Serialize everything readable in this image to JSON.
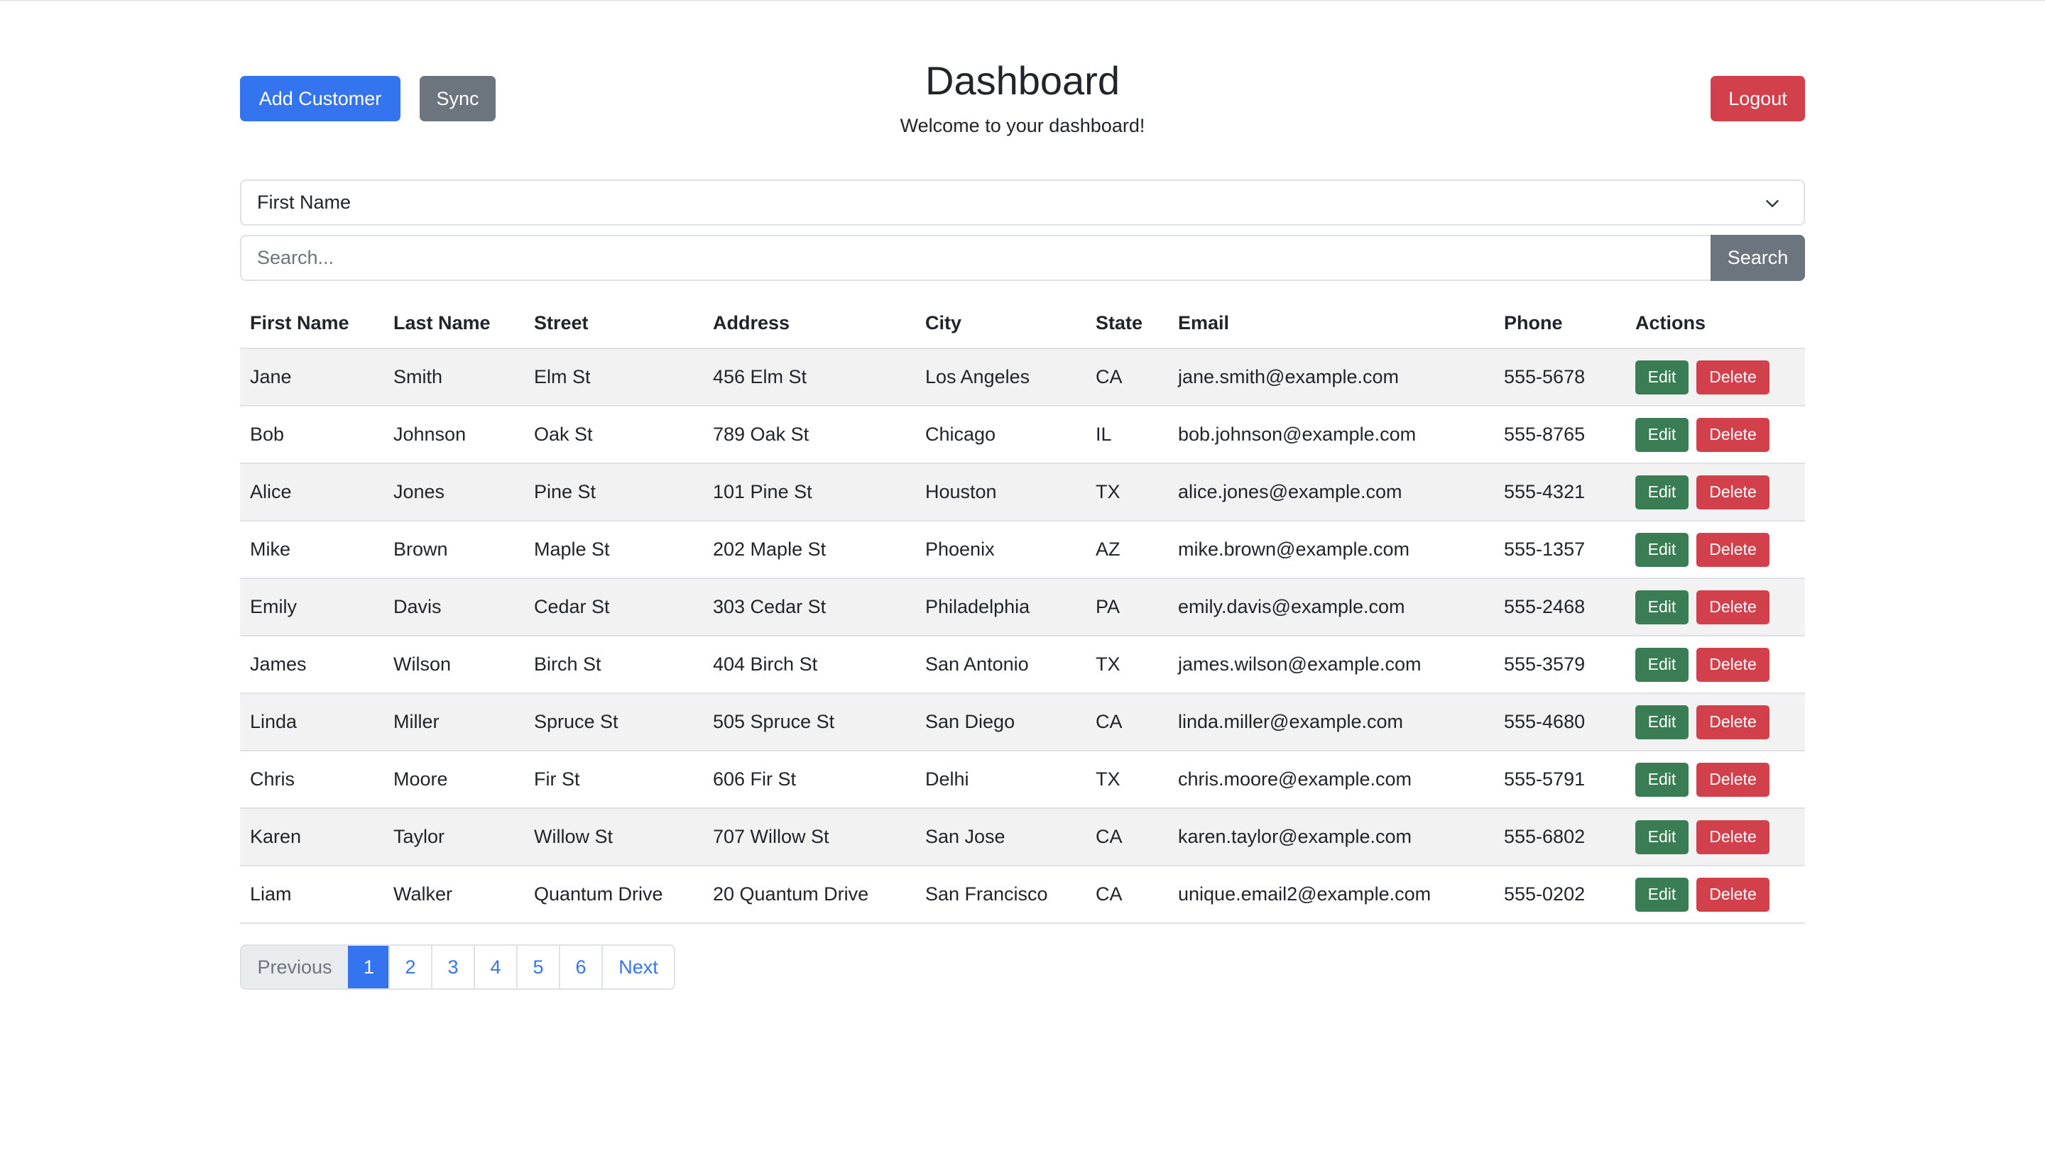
{
  "header": {
    "add_label": "Add Customer",
    "sync_label": "Sync",
    "logout_label": "Logout",
    "title": "Dashboard",
    "subtitle": "Welcome to your dashboard!"
  },
  "filter": {
    "selected": "First Name"
  },
  "search": {
    "placeholder": "Search...",
    "button_label": "Search"
  },
  "table": {
    "columns": [
      "First Name",
      "Last Name",
      "Street",
      "Address",
      "City",
      "State",
      "Email",
      "Phone",
      "Actions"
    ],
    "edit_label": "Edit",
    "delete_label": "Delete",
    "rows": [
      [
        "Jane",
        "Smith",
        "Elm St",
        "456 Elm St",
        "Los Angeles",
        "CA",
        "jane.smith@example.com",
        "555-5678"
      ],
      [
        "Bob",
        "Johnson",
        "Oak St",
        "789 Oak St",
        "Chicago",
        "IL",
        "bob.johnson@example.com",
        "555-8765"
      ],
      [
        "Alice",
        "Jones",
        "Pine St",
        "101 Pine St",
        "Houston",
        "TX",
        "alice.jones@example.com",
        "555-4321"
      ],
      [
        "Mike",
        "Brown",
        "Maple St",
        "202 Maple St",
        "Phoenix",
        "AZ",
        "mike.brown@example.com",
        "555-1357"
      ],
      [
        "Emily",
        "Davis",
        "Cedar St",
        "303 Cedar St",
        "Philadelphia",
        "PA",
        "emily.davis@example.com",
        "555-2468"
      ],
      [
        "James",
        "Wilson",
        "Birch St",
        "404 Birch St",
        "San Antonio",
        "TX",
        "james.wilson@example.com",
        "555-3579"
      ],
      [
        "Linda",
        "Miller",
        "Spruce St",
        "505 Spruce St",
        "San Diego",
        "CA",
        "linda.miller@example.com",
        "555-4680"
      ],
      [
        "Chris",
        "Moore",
        "Fir St",
        "606 Fir St",
        "Delhi",
        "TX",
        "chris.moore@example.com",
        "555-5791"
      ],
      [
        "Karen",
        "Taylor",
        "Willow St",
        "707 Willow St",
        "San Jose",
        "CA",
        "karen.taylor@example.com",
        "555-6802"
      ],
      [
        "Liam",
        "Walker",
        "Quantum Drive",
        "20 Quantum Drive",
        "San Francisco",
        "CA",
        "unique.email2@example.com",
        "555-0202"
      ]
    ]
  },
  "pagination": {
    "previous_label": "Previous",
    "next_label": "Next",
    "pages": [
      "1",
      "2",
      "3",
      "4",
      "5",
      "6"
    ],
    "active_page": "1"
  },
  "colors": {
    "primary": "#3574ef",
    "secondary": "#6c757d",
    "danger": "#d2404b",
    "success": "#3a7d54"
  },
  "icons": {
    "select_indicator": "chevron-down-icon"
  }
}
